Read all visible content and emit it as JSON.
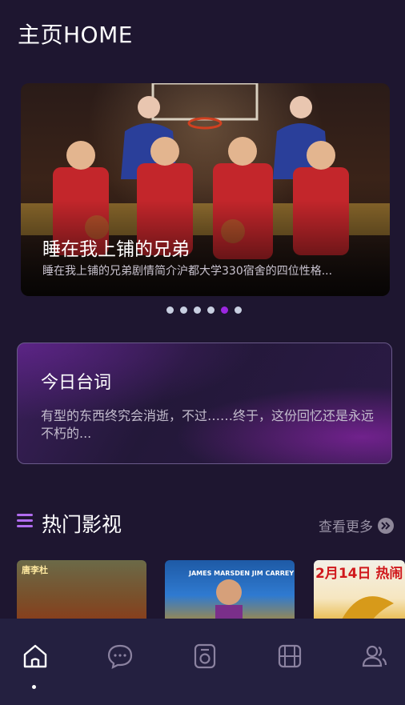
{
  "header": {
    "title": "主页HOME"
  },
  "banner": {
    "title": "睡在我上铺的兄弟",
    "description": "睡在我上铺的兄弟剧情简介沪都大学330宿舍的四位性格...",
    "dots": 6,
    "active_dot": 4
  },
  "quote": {
    "title": "今日台词",
    "text": "有型的东西终究会消逝，不过……终于，这份回忆还是永远不朽的..."
  },
  "popular": {
    "title": "热门影视",
    "more_label": "查看更多",
    "posters": [
      {
        "text": "唐李杜"
      },
      {
        "text": "JAMES MARSDEN   JIM CARREY"
      },
      {
        "text": "2月14日 热闹"
      }
    ]
  },
  "tabs": [
    {
      "icon": "home-icon",
      "active": true
    },
    {
      "icon": "chat-icon",
      "active": false
    },
    {
      "icon": "camera-icon",
      "active": false
    },
    {
      "icon": "film-icon",
      "active": false
    },
    {
      "icon": "users-icon",
      "active": false
    }
  ],
  "colors": {
    "background": "#1e1630",
    "accent": "#9c27e0",
    "tabbar": "#242040"
  }
}
